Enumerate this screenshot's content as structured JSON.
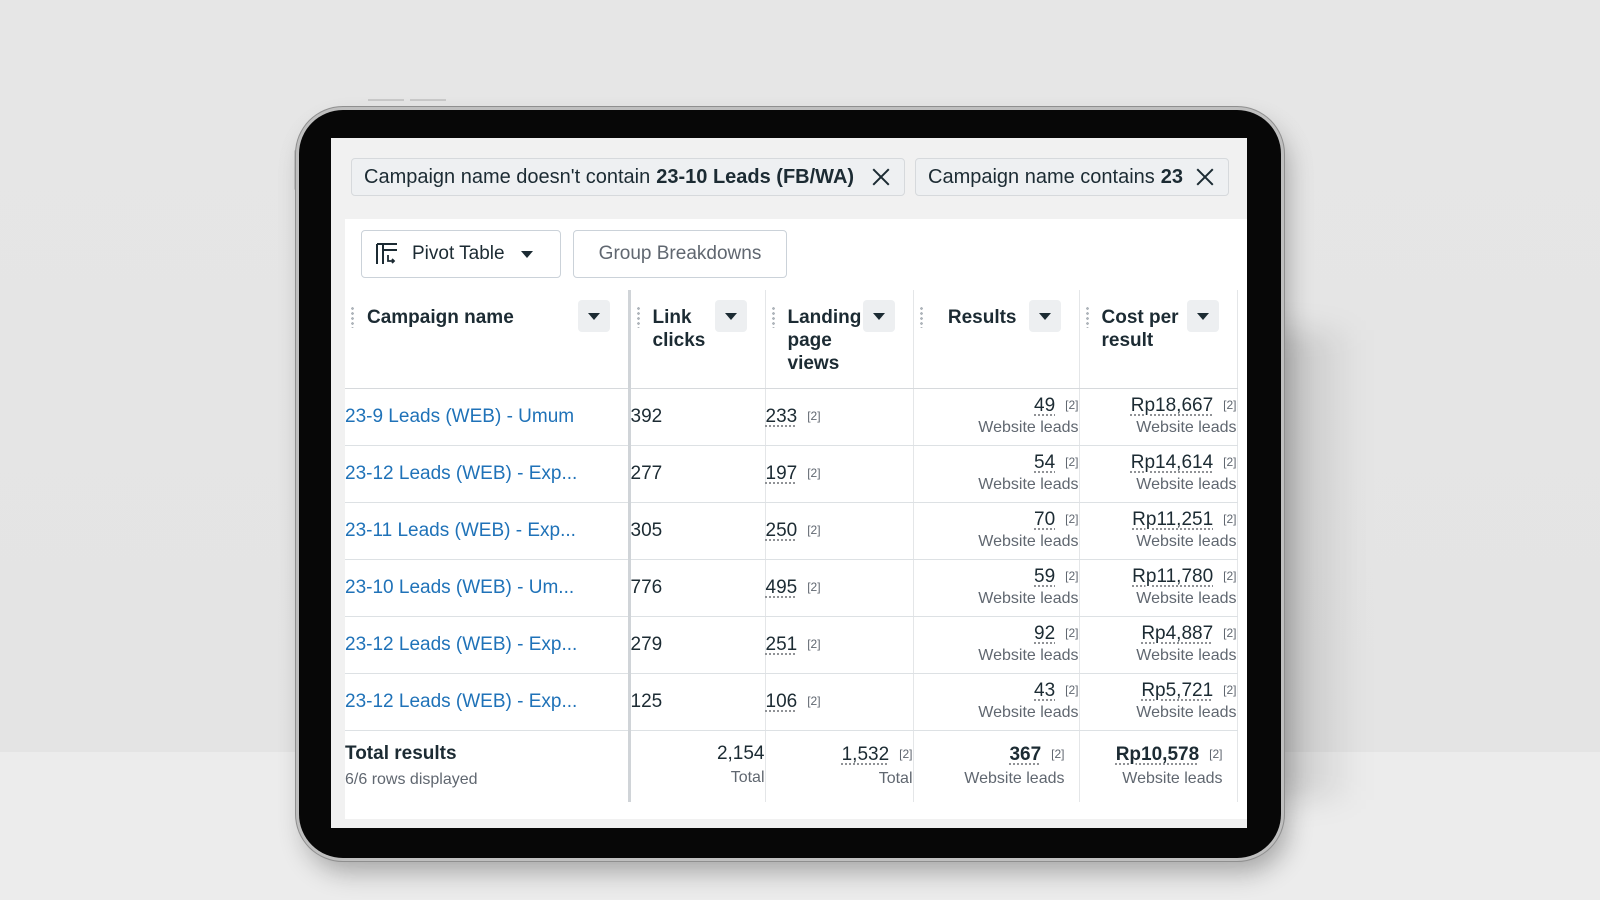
{
  "filters": [
    {
      "prefix": "Campaign name doesn't contain",
      "value": "23-10 Leads (FB/WA)"
    },
    {
      "prefix": "Campaign name contains",
      "value": "23"
    }
  ],
  "toolbar": {
    "view_label": "Pivot Table",
    "group_label": "Group Breakdowns"
  },
  "columns": {
    "campaign": "Campaign name",
    "link_clicks": "Link clicks",
    "landing": "Landing page views",
    "results": "Results",
    "cpr": "Cost per result"
  },
  "rows": [
    {
      "name": "23-9 Leads (WEB) - Umum",
      "clicks": "392",
      "lpv": "233",
      "lpv_fn": "[2]",
      "results": "49",
      "results_fn": "[2]",
      "results_sub": "Website leads",
      "cpr": "Rp18,667",
      "cpr_fn": "[2]",
      "cpr_sub": "Website leads"
    },
    {
      "name": "23-12 Leads (WEB) - Exp...",
      "clicks": "277",
      "lpv": "197",
      "lpv_fn": "[2]",
      "results": "54",
      "results_fn": "[2]",
      "results_sub": "Website leads",
      "cpr": "Rp14,614",
      "cpr_fn": "[2]",
      "cpr_sub": "Website leads"
    },
    {
      "name": "23-11 Leads (WEB) - Exp...",
      "clicks": "305",
      "lpv": "250",
      "lpv_fn": "[2]",
      "results": "70",
      "results_fn": "[2]",
      "results_sub": "Website leads",
      "cpr": "Rp11,251",
      "cpr_fn": "[2]",
      "cpr_sub": "Website leads"
    },
    {
      "name": "23-10 Leads (WEB) - Um...",
      "clicks": "776",
      "lpv": "495",
      "lpv_fn": "[2]",
      "results": "59",
      "results_fn": "[2]",
      "results_sub": "Website leads",
      "cpr": "Rp11,780",
      "cpr_fn": "[2]",
      "cpr_sub": "Website leads"
    },
    {
      "name": "23-12 Leads (WEB) - Exp...",
      "clicks": "279",
      "lpv": "251",
      "lpv_fn": "[2]",
      "results": "92",
      "results_fn": "[2]",
      "results_sub": "Website leads",
      "cpr": "Rp4,887",
      "cpr_fn": "[2]",
      "cpr_sub": "Website leads"
    },
    {
      "name": "23-12 Leads (WEB) - Exp...",
      "clicks": "125",
      "lpv": "106",
      "lpv_fn": "[2]",
      "results": "43",
      "results_fn": "[2]",
      "results_sub": "Website leads",
      "cpr": "Rp5,721",
      "cpr_fn": "[2]",
      "cpr_sub": "Website leads"
    }
  ],
  "totals": {
    "title": "Total results",
    "rows_displayed": "6/6 rows displayed",
    "clicks": "2,154",
    "clicks_cap": "Total",
    "lpv": "1,532",
    "lpv_fn": "[2]",
    "lpv_cap": "Total",
    "results": "367",
    "results_fn": "[2]",
    "results_cap": "Website leads",
    "cpr": "Rp10,578",
    "cpr_fn": "[2]",
    "cpr_cap": "Website leads"
  }
}
